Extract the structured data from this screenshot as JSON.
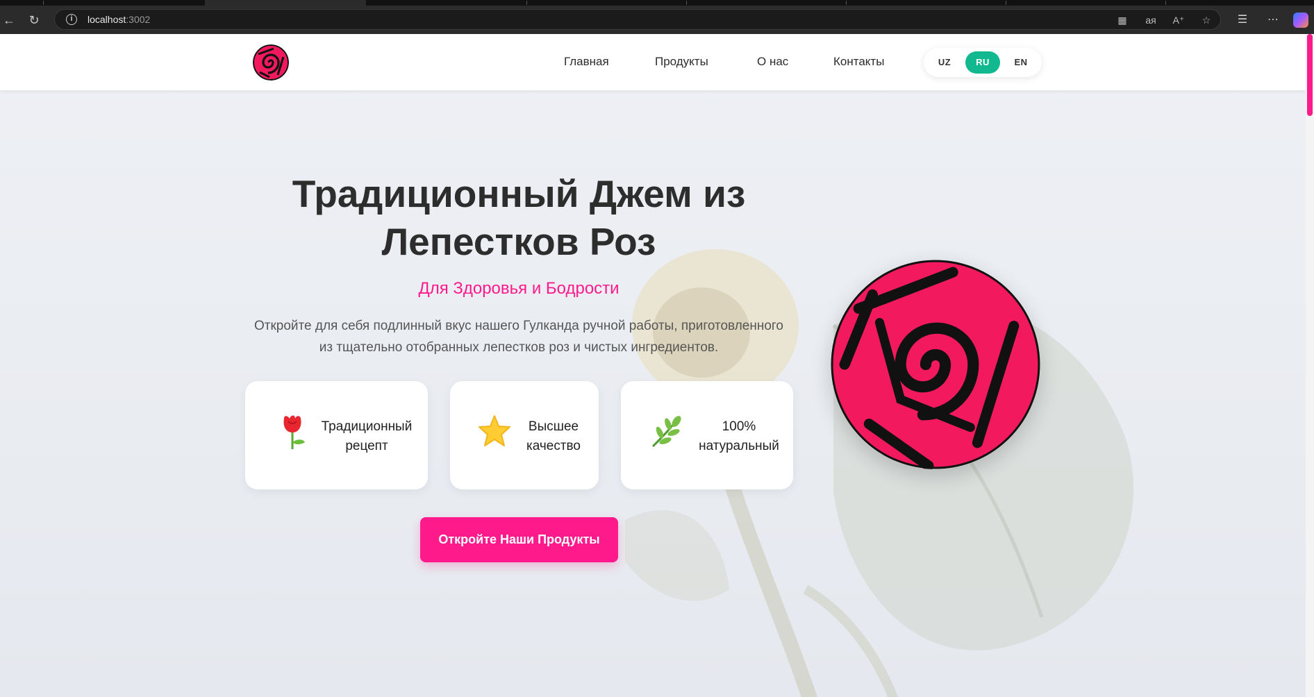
{
  "browser": {
    "url_host": "localhost",
    "url_port": ":3002",
    "icons": [
      "back-icon",
      "reload-icon",
      "info-icon",
      "apps-icon",
      "translate-icon",
      "read-aloud-icon",
      "favorite-star-icon",
      "favorites-icon",
      "more-icon",
      "copilot-icon"
    ]
  },
  "header": {
    "nav": [
      "Главная",
      "Продукты",
      "О нас",
      "Контакты"
    ],
    "languages": [
      "UZ",
      "RU",
      "EN"
    ],
    "active_language": "RU"
  },
  "hero": {
    "title_line1": "Традиционный Джем из",
    "title_line2": "Лепестков Роз",
    "subtitle": "Для Здоровья и Бодрости",
    "description_line1": "Откройте для себя подлинный вкус нашего Гулканда ручной работы, приготовленного",
    "description_line2": "из тщательно отобранных лепестков роз и чистых ингредиентов.",
    "features": [
      {
        "icon": "rose-icon",
        "line1": "Традиционный",
        "line2": "рецепт"
      },
      {
        "icon": "star-icon",
        "line1": "Высшее",
        "line2": "качество"
      },
      {
        "icon": "leaf-icon",
        "line1": "100%",
        "line2": "натуральный"
      }
    ],
    "cta_label": "Откройте Наши Продукты"
  },
  "colors": {
    "accent": "#ff1a8c",
    "language_active": "#12b890",
    "title": "#2d2d2d"
  }
}
